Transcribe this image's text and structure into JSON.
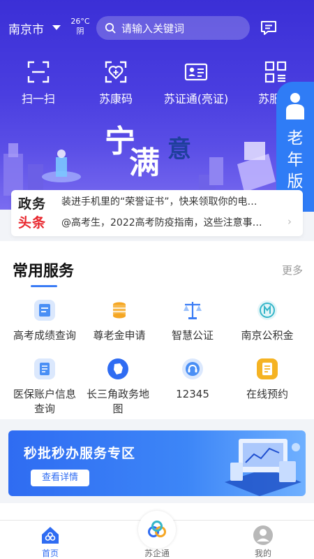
{
  "header": {
    "city": "南京市",
    "weather_temp": "26°C",
    "weather_desc": "阴",
    "search_placeholder": "请输入关键词"
  },
  "quick_actions": [
    {
      "label": "扫一扫",
      "icon": "scan-icon"
    },
    {
      "label": "苏康码",
      "icon": "health-code-icon"
    },
    {
      "label": "苏证通(亮证)",
      "icon": "id-card-icon"
    },
    {
      "label": "苏服",
      "icon": "grid-icon"
    }
  ],
  "elder_mode": {
    "label_1": "老",
    "label_2": "年",
    "label_3": "版"
  },
  "banner": {
    "text_1": "宁",
    "text_2": "满",
    "text_3": "意"
  },
  "news": {
    "logo_top": "政务",
    "logo_bottom": "头条",
    "items": [
      "装进手机里的“荣誉证书”，快来领取你的电…",
      "@高考生，2022高考防疫指南，这些注意事…"
    ]
  },
  "services": {
    "title": "常用服务",
    "more": "更多",
    "items": [
      {
        "label": "高考成绩查询",
        "icon": "exam-score-icon",
        "color": "#4a8ff5"
      },
      {
        "label": "尊老金申请",
        "icon": "coins-icon",
        "color": "#f5a623"
      },
      {
        "label": "智慧公证",
        "icon": "scales-icon",
        "color": "#3a7cf5"
      },
      {
        "label": "南京公积金",
        "icon": "fund-icon",
        "color": "#35b6c9"
      },
      {
        "label": "医保账户信息查询",
        "label_line1": "医保账户信息",
        "label_line2": "查询",
        "icon": "medical-card-icon",
        "color": "#4a8ff5"
      },
      {
        "label": "长三角政务地图",
        "label_line1": "长三角政务地",
        "label_line2": "图",
        "icon": "map-icon",
        "color": "#2f6cf2"
      },
      {
        "label": "12345",
        "icon": "hotline-icon",
        "color": "#4a8ff5"
      },
      {
        "label": "在线预约",
        "icon": "appointment-icon",
        "color": "#f5b323"
      }
    ]
  },
  "promo": {
    "title": "秒批秒办服务专区",
    "button": "查看详情"
  },
  "tabbar": [
    {
      "label": "首页",
      "icon": "home-icon",
      "active": true
    },
    {
      "label": "苏企通",
      "icon": "enterprise-logo-icon",
      "active": false
    },
    {
      "label": "我的",
      "icon": "user-icon",
      "active": false
    }
  ]
}
